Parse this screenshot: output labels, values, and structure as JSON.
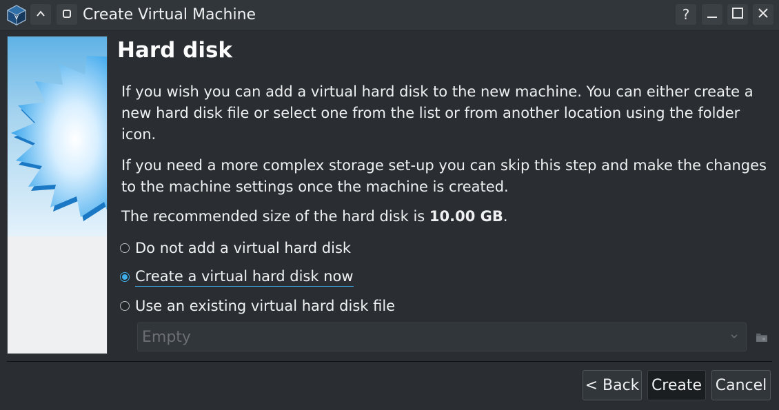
{
  "window": {
    "title": "Create Virtual Machine",
    "help_label": "?",
    "minimize_label": "—",
    "maximize_label": "☐",
    "close_label": "✕",
    "keep_above_icon": "chevron-up-icon",
    "on_all_desktops_icon": "square-icon"
  },
  "page": {
    "heading": "Hard disk",
    "paragraph1": "If you wish you can add a virtual hard disk to the new machine. You can either create a new hard disk file or select one from the list or from another location using the folder icon.",
    "paragraph2": "If you need a more complex storage set-up you can skip this step and make the changes to the machine settings once the machine is created.",
    "recommended_prefix": "The recommended size of the hard disk is ",
    "recommended_size": "10.00 GB",
    "recommended_suffix": "."
  },
  "options": [
    {
      "label": "Do not add a virtual hard disk",
      "checked": false
    },
    {
      "label": "Create a virtual hard disk now",
      "checked": true
    },
    {
      "label": "Use an existing virtual hard disk file",
      "checked": false
    }
  ],
  "disk_select": {
    "value": "Empty",
    "enabled": false
  },
  "buttons": {
    "back": "< Back",
    "create": "Create",
    "cancel": "Cancel"
  },
  "colors": {
    "accent": "#3daee9",
    "background": "#2a2e32",
    "titlebar": "#31363b"
  }
}
